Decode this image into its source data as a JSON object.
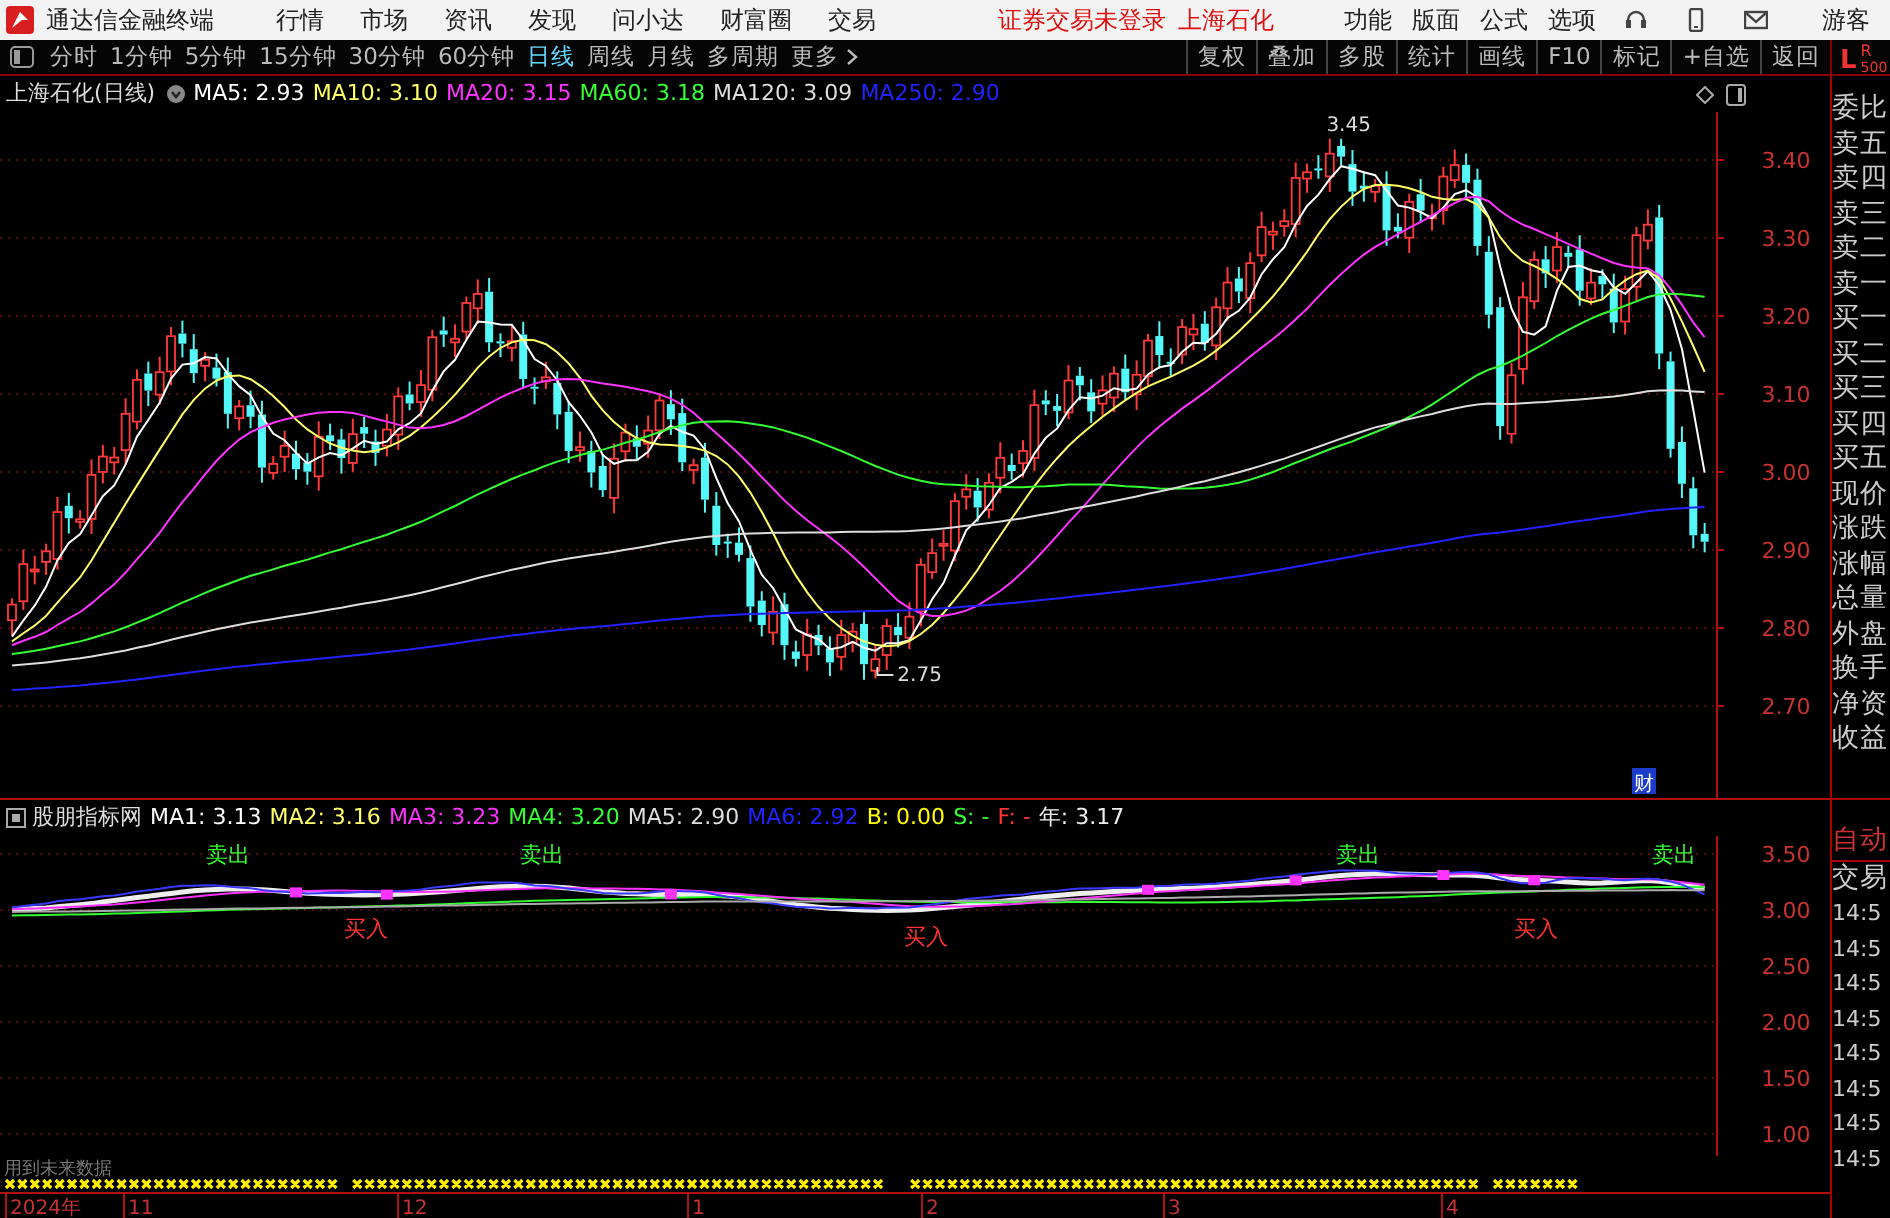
{
  "app": {
    "title": "通达信金融终端"
  },
  "menu": [
    "行情",
    "市场",
    "资讯",
    "发现",
    "问小达",
    "财富圈",
    "交易"
  ],
  "login_status": {
    "notice": "证券交易未登录",
    "stock": "上海石化"
  },
  "right_menu": [
    "功能",
    "版面",
    "公式",
    "选项"
  ],
  "user": "游客",
  "periods": [
    {
      "label": "分时",
      "selected": false
    },
    {
      "label": "1分钟",
      "selected": false
    },
    {
      "label": "5分钟",
      "selected": false
    },
    {
      "label": "15分钟",
      "selected": false
    },
    {
      "label": "30分钟",
      "selected": false
    },
    {
      "label": "60分钟",
      "selected": false
    },
    {
      "label": "日线",
      "selected": true
    },
    {
      "label": "周线",
      "selected": false
    },
    {
      "label": "月线",
      "selected": false
    },
    {
      "label": "多周期",
      "selected": false
    },
    {
      "label": "更多",
      "selected": false
    }
  ],
  "tools": [
    "复权",
    "叠加",
    "多股",
    "统计",
    "画线",
    "F10",
    "标记",
    "+自选",
    "返回"
  ],
  "level_indicator": {
    "left": "L",
    "right": "R",
    "right_sub": "500"
  },
  "main_chart": {
    "title": "上海石化(日线)",
    "averages": [
      {
        "label": "MA5: 2.93",
        "color": "#ffffff"
      },
      {
        "label": "MA10: 3.10",
        "color": "#ffff66"
      },
      {
        "label": "MA20: 3.15",
        "color": "#ff33ff"
      },
      {
        "label": "MA60: 3.18",
        "color": "#33ff33"
      },
      {
        "label": "MA120: 3.09",
        "color": "#dddddd"
      },
      {
        "label": "MA250: 2.90",
        "color": "#2222ff"
      }
    ],
    "y_labels": [
      "3.40",
      "3.30",
      "3.20",
      "3.10",
      "3.00",
      "2.90",
      "2.80",
      "2.70"
    ],
    "high_label": "3.45",
    "low_label": "2.75",
    "event_marker": "财"
  },
  "indicator": {
    "title": "股朋指标网",
    "values": [
      {
        "label": "MA1: 3.13",
        "color": "#ffffff"
      },
      {
        "label": "MA2: 3.16",
        "color": "#ffff66"
      },
      {
        "label": "MA3: 3.23",
        "color": "#ff33ff"
      },
      {
        "label": "MA4: 3.20",
        "color": "#33ff33"
      },
      {
        "label": "MA5: 2.90",
        "color": "#dddddd"
      },
      {
        "label": "MA6: 2.92",
        "color": "#2222ff"
      },
      {
        "label": "B: 0.00",
        "color": "#ffff00"
      },
      {
        "label": "S: -",
        "color": "#33ff33"
      },
      {
        "label": "F: -",
        "color": "#ff3333"
      },
      {
        "label": "年: 3.17",
        "color": "#eeeeee"
      }
    ],
    "signals": [
      {
        "kind": "sell",
        "text": "卖出"
      },
      {
        "kind": "buy",
        "text": "买入"
      },
      {
        "kind": "sell",
        "text": "卖出"
      },
      {
        "kind": "buy",
        "text": "买入"
      },
      {
        "kind": "sell",
        "text": "卖出"
      },
      {
        "kind": "buy",
        "text": "买入"
      },
      {
        "kind": "sell",
        "text": "卖出"
      }
    ],
    "y_labels": [
      "3.50",
      "3.00",
      "2.50",
      "2.00",
      "1.50",
      "1.00"
    ],
    "note": "用到未来数据"
  },
  "x_axis": [
    "2024年",
    "11",
    "12",
    "1",
    "2",
    "3",
    "4"
  ],
  "quote_panel": [
    "委比",
    "卖五",
    "卖四",
    "卖三",
    "卖二",
    "卖一",
    "买一",
    "买二",
    "买三",
    "买四",
    "买五",
    "现价",
    "涨跌",
    "涨幅",
    "总量",
    "外盘",
    "换手",
    "净资",
    "收益"
  ],
  "trade_panel": {
    "title": "自动",
    "tab": "交易",
    "times": [
      "14:5",
      "14:5",
      "14:5",
      "14:5",
      "14:5",
      "14:5",
      "14:5",
      "14:5"
    ]
  }
}
